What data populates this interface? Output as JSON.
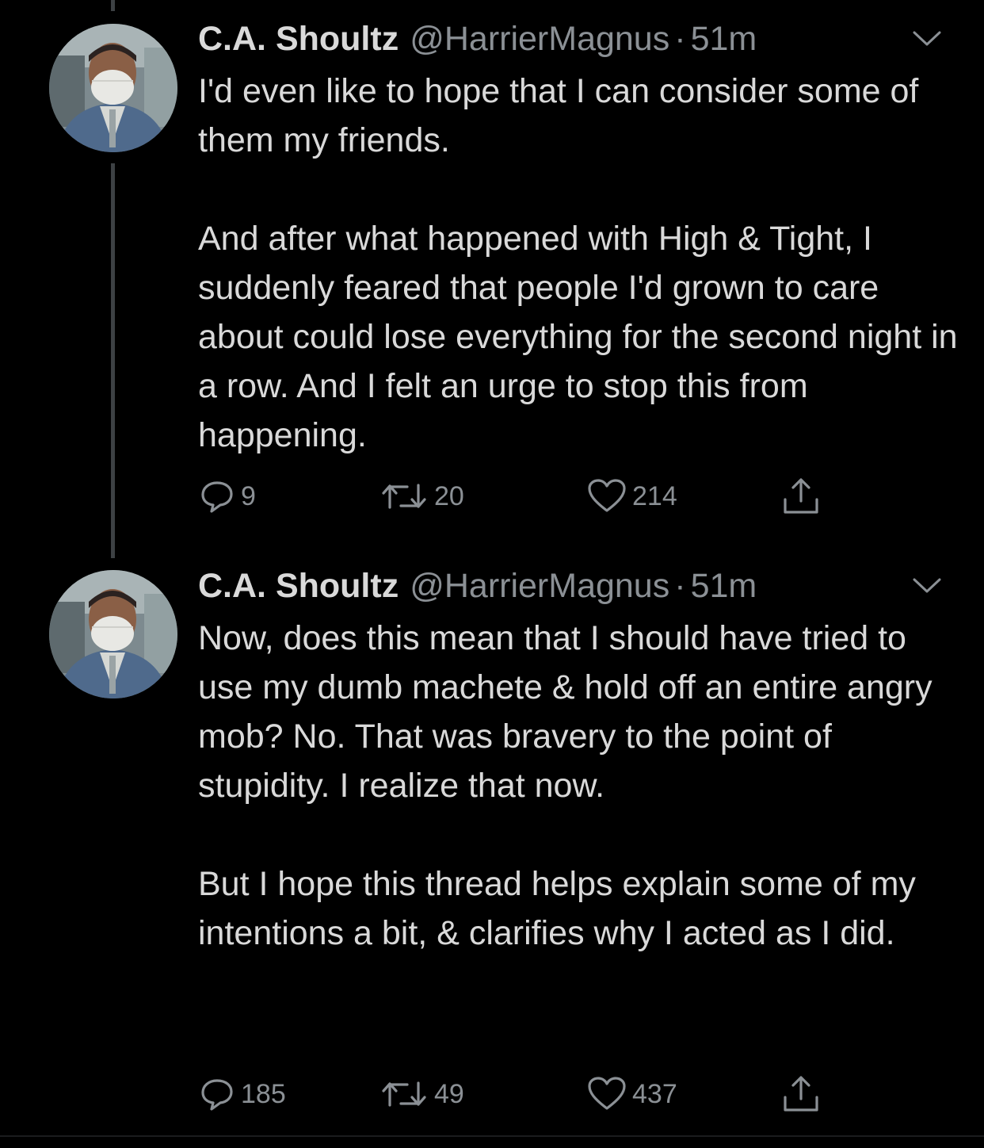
{
  "colors": {
    "background": "#000000",
    "text": "#d9d9d9",
    "muted": "#8b9095",
    "thread_line": "#3d4144"
  },
  "tweets": [
    {
      "name": "C.A. Shoultz",
      "handle": "@HarrierMagnus",
      "separator": "·",
      "time": "51m",
      "paragraphs": [
        "I'd even like to hope that I can consider some of them my friends.",
        "And after what happened with High & Tight, I suddenly feared that people I'd grown to care about could lose everything for the second night in a row. And I felt an urge to stop this from happening."
      ],
      "replies": "9",
      "retweets": "20",
      "likes": "214",
      "icons": {
        "reply": "reply-icon",
        "retweet": "retweet-icon",
        "like": "heart-icon",
        "share": "share-icon",
        "menu": "chevron-down-icon"
      }
    },
    {
      "name": "C.A. Shoultz",
      "handle": "@HarrierMagnus",
      "separator": "·",
      "time": "51m",
      "paragraphs": [
        "Now, does this mean that I should have tried to use my dumb machete & hold off an entire angry mob?  No.  That was bravery to the point of stupidity.  I realize that now.",
        "But I hope this thread helps explain some of my intentions a bit, & clarifies why I acted as I did."
      ],
      "replies": "185",
      "retweets": "49",
      "likes": "437",
      "icons": {
        "reply": "reply-icon",
        "retweet": "retweet-icon",
        "like": "heart-icon",
        "share": "share-icon",
        "menu": "chevron-down-icon"
      }
    }
  ]
}
